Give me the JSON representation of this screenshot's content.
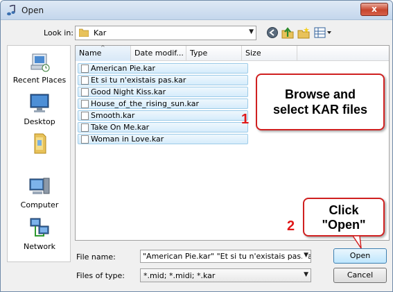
{
  "window": {
    "title": "Open",
    "close_glyph": "x"
  },
  "lookin": {
    "label": "Look in:",
    "value": "Kar",
    "arrow": "▼"
  },
  "nav_icons": [
    "back-icon",
    "up-folder-icon",
    "new-folder-icon",
    "views-icon"
  ],
  "places": [
    {
      "label": "Recent Places",
      "icon": "recent-places-icon"
    },
    {
      "label": "Desktop",
      "icon": "desktop-icon"
    },
    {
      "label": "",
      "icon": "user-folder-icon"
    },
    {
      "label": "Computer",
      "icon": "computer-icon"
    },
    {
      "label": "Network",
      "icon": "network-icon"
    }
  ],
  "columns": {
    "name": "Name",
    "date": "Date modif...",
    "type": "Type",
    "size": "Size",
    "sort_glyph": "^"
  },
  "files": [
    "American Pie.kar",
    "Et si tu n'existais pas.kar",
    "Good Night Kiss.kar",
    "House_of_the_rising_sun.kar",
    "Smooth.kar",
    "Take On Me.kar",
    "Woman in Love.kar"
  ],
  "callouts": {
    "browse_line1": "Browse and",
    "browse_line2": "select KAR files",
    "click_line1": "Click",
    "click_line2": "\"Open\"",
    "step1": "1",
    "step2": "2"
  },
  "filename": {
    "label": "File name:",
    "value": "\"American Pie.kar\" \"Et si tu n'existais pas.kar\" \"",
    "arrow": "▼"
  },
  "filetype": {
    "label": "Files of type:",
    "value": "*.mid; *.midi; *.kar",
    "arrow": "▼"
  },
  "buttons": {
    "open": "Open",
    "cancel": "Cancel"
  },
  "colors": {
    "accent": "#3c7fb1",
    "callout_border": "#d02020",
    "step_number": "#e01818"
  }
}
